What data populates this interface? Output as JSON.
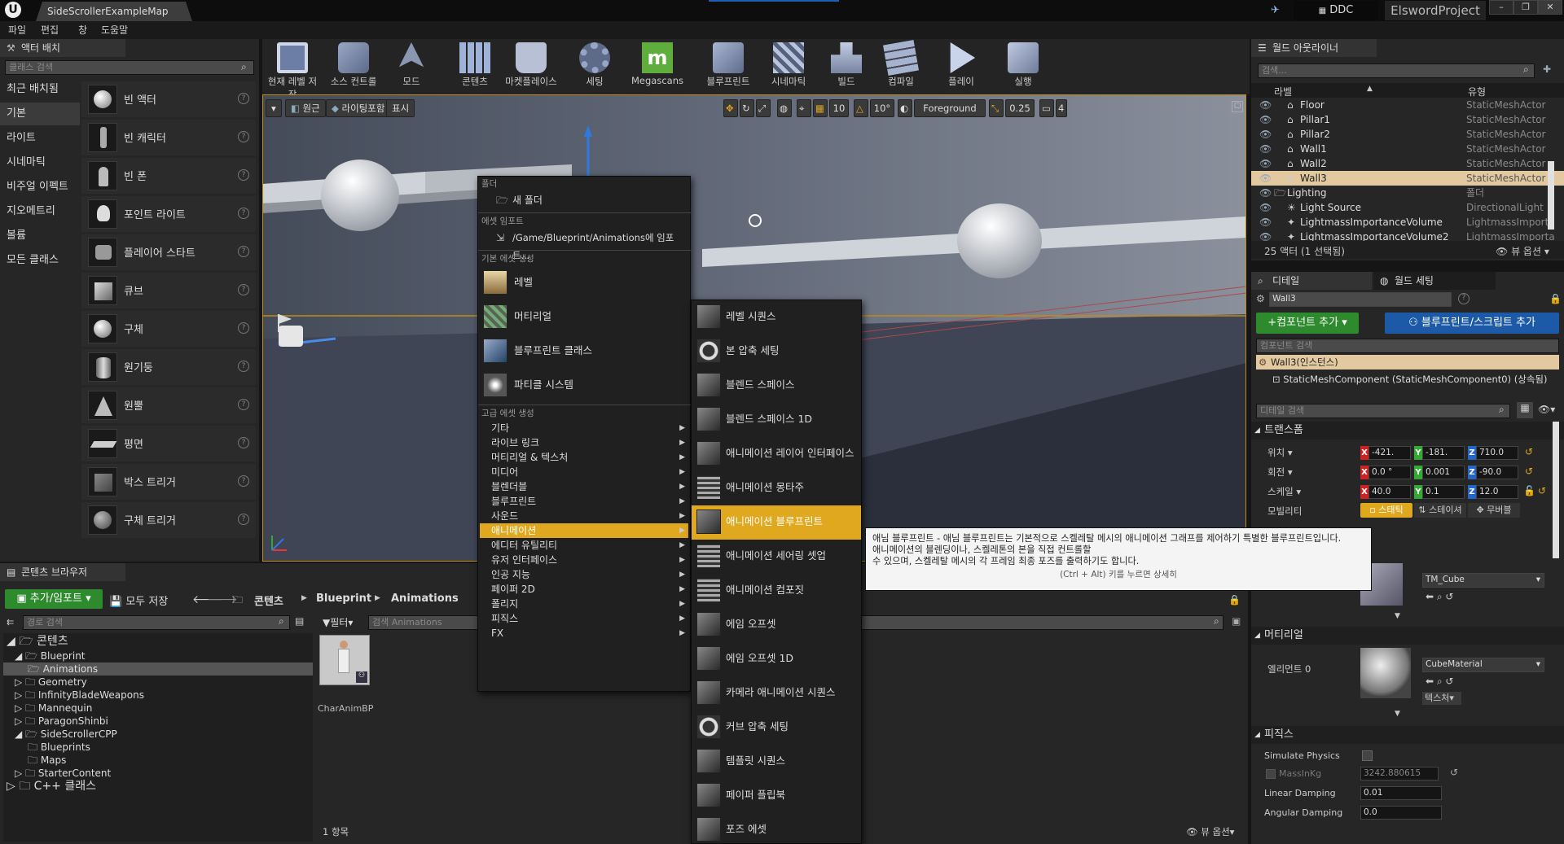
{
  "titlebar": {
    "app_logo": "U",
    "doc_tab": "SideScrollerExampleMap",
    "ddc": "DDC",
    "project": "ElswordProject"
  },
  "menubar": [
    "파일",
    "편집",
    "창",
    "도움말"
  ],
  "modes": {
    "title": "액터 배치",
    "search_placeholder": "클래스 검색",
    "categories": [
      "최근 배치됨",
      "기본",
      "라이트",
      "시네마틱",
      "비주얼 이펙트",
      "지오메트리",
      "볼륨",
      "모든 클래스"
    ],
    "items": [
      "빈 액터",
      "빈 캐릭터",
      "빈 폰",
      "포인트 라이트",
      "플레이어 스타트",
      "큐브",
      "구체",
      "원기둥",
      "원뿔",
      "평면",
      "박스 트리거",
      "구체 트리거"
    ]
  },
  "toolbar": [
    "현재 레벨 저장",
    "소스 컨트롤",
    "모드",
    "콘텐츠",
    "마켓플레이스",
    "세팅",
    "Megascans",
    "블루프린트",
    "시네마틱",
    "빌드",
    "컴파일",
    "플레이",
    "실행"
  ],
  "viewport": {
    "view_mode": "원근",
    "lighting": "라이팅포함",
    "show": "표시",
    "grid": "10",
    "rot": "10°",
    "layer": "Foreground",
    "scale": "0.25",
    "cam": "4"
  },
  "outliner": {
    "title": "월드 아웃라이너",
    "search_placeholder": "검색...",
    "col_label": "라벨",
    "col_type": "유형",
    "rows": [
      {
        "n": "Floor",
        "t": "StaticMeshActor"
      },
      {
        "n": "Pillar1",
        "t": "StaticMeshActor"
      },
      {
        "n": "Pillar2",
        "t": "StaticMeshActor"
      },
      {
        "n": "Wall1",
        "t": "StaticMeshActor"
      },
      {
        "n": "Wall2",
        "t": "StaticMeshActor"
      },
      {
        "n": "Wall3",
        "t": "StaticMeshActor"
      },
      {
        "n": "Lighting",
        "t": "폴더"
      },
      {
        "n": "Light Source",
        "t": "DirectionalLight"
      },
      {
        "n": "LightmassImportanceVolume",
        "t": "LightmassImporta"
      },
      {
        "n": "LightmassImportanceVolume2",
        "t": "LightmassImporta"
      }
    ],
    "count": "25 액터 (1 선택됨)",
    "view_options": "뷰 옵션"
  },
  "details": {
    "tab1": "디테일",
    "tab2": "월드 세팅",
    "name": "Wall3",
    "add_component": "+컴포넌트 추가",
    "add_script": "블루프린트/스크립트 추가",
    "comp_search": "컴포넌트 검색",
    "instance": "Wall3(인스턴스)",
    "component": "StaticMeshComponent (StaticMeshComponent0) (상속됨)",
    "detail_search": "디테일 검색",
    "transform": "트랜스폼",
    "loc": "위치",
    "rot": "회전",
    "scale": "스케일",
    "mobility": "모빌리티",
    "loc_v": [
      "-421.",
      "-181.",
      "710.0"
    ],
    "rot_v": [
      "0.0 °",
      "0.001",
      "-90.0"
    ],
    "scale_v": [
      "40.0",
      "0.1",
      "12.0"
    ],
    "mob": [
      "스태틱",
      "스테이셔",
      "무버블"
    ],
    "mesh": "TM_Cube",
    "material_sect": "머티리얼",
    "element": "엘리먼트 0",
    "material": "CubeMaterial",
    "texture": "텍스처",
    "physics": "피직스",
    "sim": "Simulate Physics",
    "mass": "MassInKg",
    "mass_v": "3242.880615",
    "lin": "Linear Damping",
    "lin_v": "0.01",
    "ang": "Angular Damping",
    "ang_v": "0.0"
  },
  "cb": {
    "tab": "콘텐츠 브라우저",
    "add": "추가/임포트",
    "save": "모두 저장",
    "crumbs": [
      "콘텐츠",
      "Blueprint",
      "Animations"
    ],
    "path_search": "경로 검색",
    "filter": "필터",
    "asset_search": "검색 Animations",
    "tree": [
      "콘텐츠",
      "Blueprint",
      "Animations",
      "Geometry",
      "InfinityBladeWeapons",
      "Mannequin",
      "ParagonShinbi",
      "SideScrollerCPP",
      "Blueprints",
      "Maps",
      "StarterContent",
      "C++ 클래스"
    ],
    "asset": "CharAnimBP",
    "count": "1 항목",
    "view_options": "뷰 옵션"
  },
  "menu": {
    "folder_hdr": "폴더",
    "new_folder": "새 폴더",
    "import_hdr": "에셋 임포트",
    "import": "/Game/Blueprint/Animations에 임포트...",
    "basic_hdr": "기본 에셋 생성",
    "basic": [
      "레벨",
      "머티리얼",
      "블루프린트 클래스",
      "파티클 시스템"
    ],
    "adv_hdr": "고급 에셋 생성",
    "adv": [
      "기타",
      "라이브 링크",
      "머티리얼 & 텍스처",
      "미디어",
      "블렌더블",
      "블루프린트",
      "사운드",
      "애니메이션",
      "에디터 유틸리티",
      "유저 인터페이스",
      "인공 지능",
      "페이퍼 2D",
      "폴리지",
      "피직스",
      "FX"
    ]
  },
  "submenu": [
    "레벨 시퀀스",
    "본 압축 세팅",
    "블렌드 스페이스",
    "블렌드 스페이스 1D",
    "애니메이션 레이어 인터페이스",
    "애니메이션 몽타주",
    "애니메이션 블루프린트",
    "애니메이션 세어링 셋업",
    "애니메이션 컴포짓",
    "에임 오프셋",
    "에임 오프셋 1D",
    "카메라 애니메이션 시퀀스",
    "커브 압축 세팅",
    "템플릿 시퀀스",
    "페이퍼 플립북",
    "포즈 에셋"
  ],
  "tooltip": {
    "l1": "애님 블루프린트 - 애님 블루프린트는 기본적으로 스켈레탈 메시의 애니메이션 그래프를 제어하기 특별한 블루프린트입니다.",
    "l2": "애니메이션의 블렌딩이나, 스켈레톤의 본을 직접 컨트롤할",
    "l3": "수 있으며, 스켈레탈 메시의 각 프레임 최종 포즈를 출력하기도 합니다.",
    "l4": "(Ctrl + Alt) 키를 누르면 상세히"
  }
}
